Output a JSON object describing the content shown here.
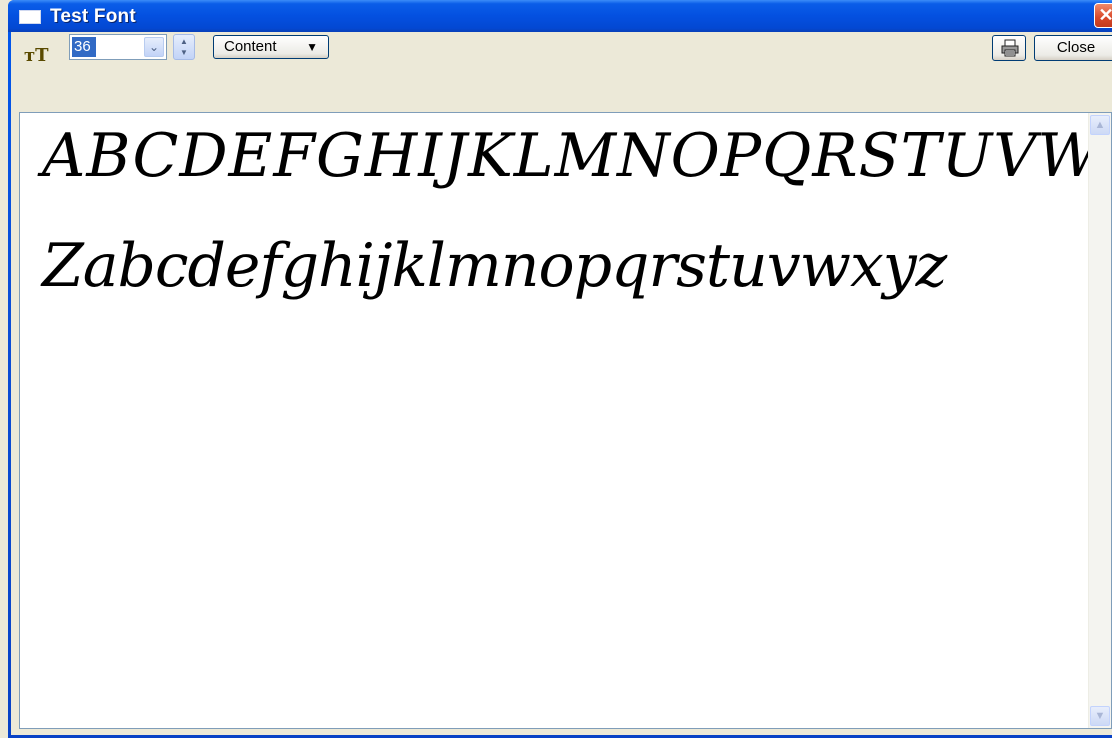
{
  "window": {
    "title": "Test Font",
    "close_glyph": "✕"
  },
  "toolbar": {
    "size_icon_glyph": "ᴛT",
    "font_size_value": "36",
    "dropdown_glyph": "⌄",
    "spinner_up": "▲",
    "spinner_down": "▼",
    "content_label": "Content",
    "content_arrow": "▼",
    "close_label": "Close"
  },
  "preview": {
    "lines": [
      "ABCDEFGHIJKLMNOPQRSTUVWXY",
      "Zabcdefghijklmnopqrstuvwxyz"
    ]
  },
  "icons": {
    "print": "printer-icon",
    "font_size": "font-size-icon"
  },
  "colors": {
    "title_blue": "#0450E0",
    "selection_blue": "#316AC5",
    "close_red": "#D8482A",
    "face": "#ECE9D8"
  }
}
